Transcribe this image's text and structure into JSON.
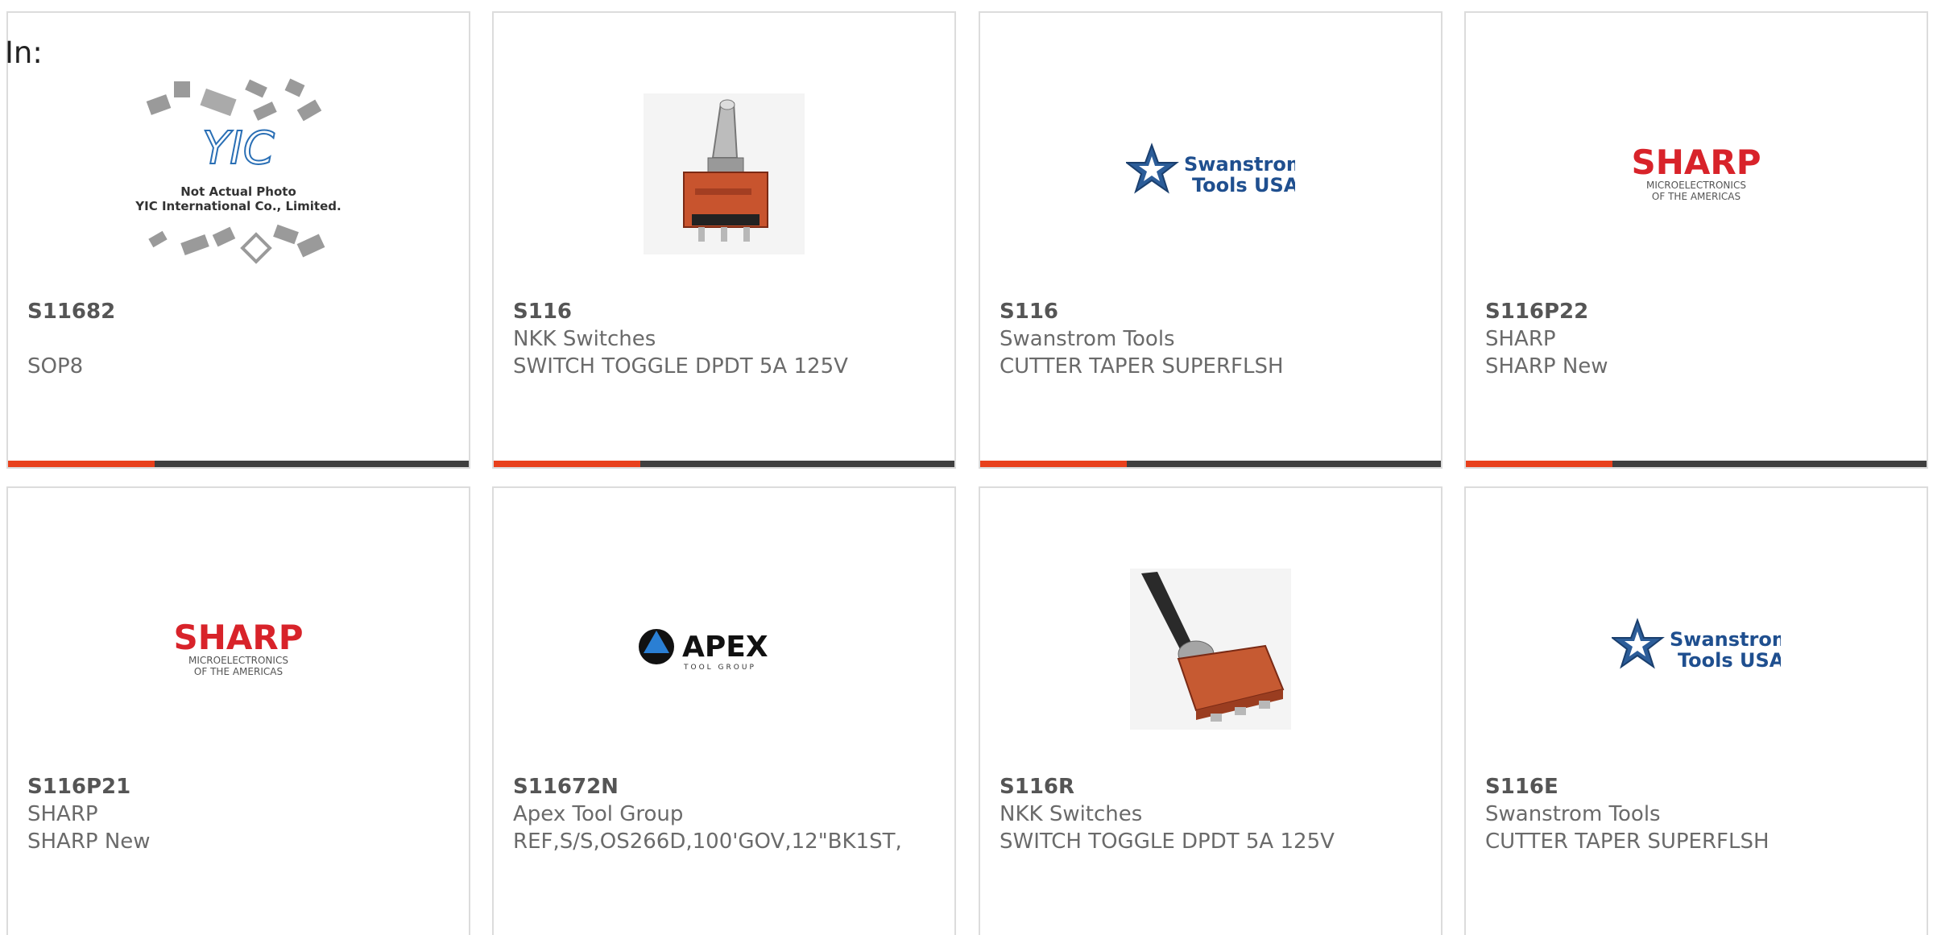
{
  "filter": {
    "label": "In:"
  },
  "colors": {
    "accent": "#e8401c",
    "bar": "#3f3f3f",
    "sharp_red": "#d8232a",
    "swanstrom_blue": "#1f4f8f"
  },
  "products": [
    {
      "part": "S11682",
      "manufacturer": "",
      "description": "SOP8",
      "image": "yic-placeholder-photo",
      "image_text": {
        "brand": "YIC",
        "line1": "Not Actual Photo",
        "line2": "YIC International Co., Limited."
      }
    },
    {
      "part": "S116",
      "manufacturer": "NKK Switches",
      "description": "SWITCH TOGGLE DPDT 5A 125V",
      "image": "toggle-switch-photo"
    },
    {
      "part": "S116",
      "manufacturer": "Swanstrom Tools",
      "description": "CUTTER TAPER SUPERFLSH",
      "image": "swanstrom-logo",
      "image_text": {
        "line1": "Swanstrom",
        "line2": "Tools USA"
      }
    },
    {
      "part": "S116P22",
      "manufacturer": "SHARP",
      "description": "SHARP New",
      "image": "sharp-logo",
      "image_text": {
        "brand": "SHARP",
        "line1": "MICROELECTRONICS",
        "line2": "OF THE AMERICAS"
      }
    },
    {
      "part": "S116P21",
      "manufacturer": "SHARP",
      "description": "SHARP New",
      "image": "sharp-logo",
      "image_text": {
        "brand": "SHARP",
        "line1": "MICROELECTRONICS",
        "line2": "OF THE AMERICAS"
      }
    },
    {
      "part": "S11672N",
      "manufacturer": "Apex Tool Group",
      "description": "REF,S/S,OS266D,100'GOV,12\"BK1ST,",
      "image": "apex-logo",
      "image_text": {
        "brand": "APEX",
        "line1": "TOOL GROUP"
      }
    },
    {
      "part": "S116R",
      "manufacturer": "NKK Switches",
      "description": "SWITCH TOGGLE DPDT 5A 125V",
      "image": "lever-switch-photo"
    },
    {
      "part": "S116E",
      "manufacturer": "Swanstrom Tools",
      "description": "CUTTER TAPER SUPERFLSH",
      "image": "swanstrom-logo",
      "image_text": {
        "line1": "Swanstrom",
        "line2": "Tools USA"
      }
    }
  ]
}
